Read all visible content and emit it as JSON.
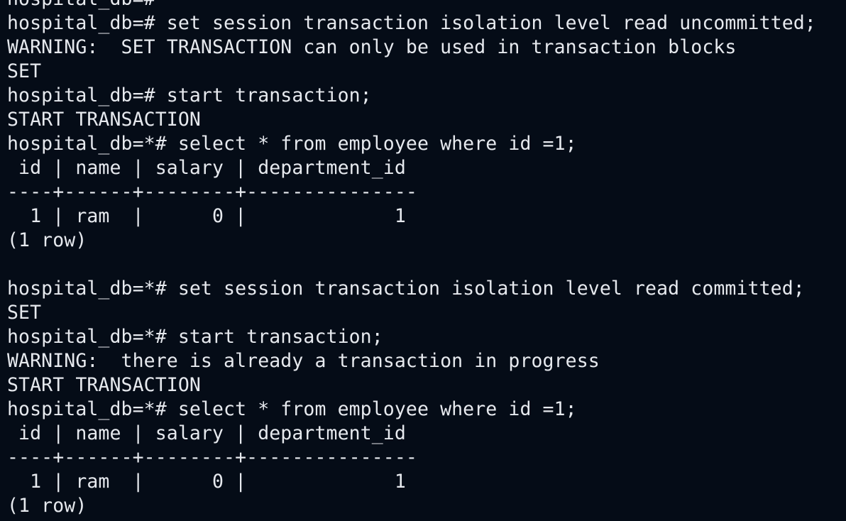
{
  "terminal": {
    "lines": [
      "hospital_db=#",
      "hospital_db=# set session transaction isolation level read uncommitted;",
      "WARNING:  SET TRANSACTION can only be used in transaction blocks",
      "SET",
      "hospital_db=# start transaction;",
      "START TRANSACTION",
      "hospital_db=*# select * from employee where id =1;",
      " id | name | salary | department_id",
      "----+------+--------+---------------",
      "  1 | ram  |      0 |             1",
      "(1 row)",
      "",
      "hospital_db=*# set session transaction isolation level read committed;",
      "SET",
      "hospital_db=*# start transaction;",
      "WARNING:  there is already a transaction in progress",
      "START TRANSACTION",
      "hospital_db=*# select * from employee where id =1;",
      " id | name | salary | department_id",
      "----+------+--------+---------------",
      "  1 | ram  |      0 |             1",
      "(1 row)"
    ]
  }
}
